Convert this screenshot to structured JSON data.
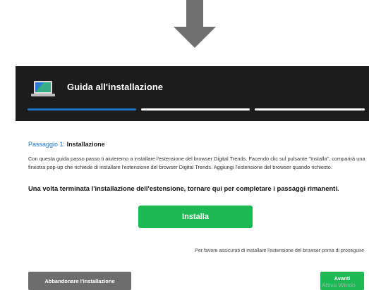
{
  "colors": {
    "header_bg": "#1c1c1c",
    "progress_active": "#1a73c7",
    "progress_inactive": "#ffffff",
    "accent_blue": "#1a73c7",
    "install_green": "#1db954",
    "abandon_gray": "#6d6d6d",
    "next_green": "#1db954",
    "arrow_gray": "#707070"
  },
  "header": {
    "title": "Guida all'installazione",
    "icon": "laptop-icon"
  },
  "progress": {
    "current_step": 1,
    "total_steps": 3
  },
  "step": {
    "number_label": "Passaggio 1:",
    "name": "Installazione"
  },
  "content": {
    "description": "Con questa guida passo passo ti aiuteremo a installare l'estensione del browser Digital Trends. Facendo clic sul pulsante \"Installa\", comparirà una finestra pop-up che richiede di installare l'estensione del browser Digital Trends. Aggiungi l'estensione del browser quando richiesto.",
    "bold_line": "Una volta terminata l'installazione dell'estensione, tornare qui per completare i passaggi rimanenti."
  },
  "install_button": {
    "label": "Installa"
  },
  "note": "Per favore assicurati di installare l'estensione del browser prima di proseguire",
  "footer": {
    "abandon_label": "Abbandonare l'installazione",
    "next_label": "Avanti"
  },
  "watermark": "Attiva Windo"
}
